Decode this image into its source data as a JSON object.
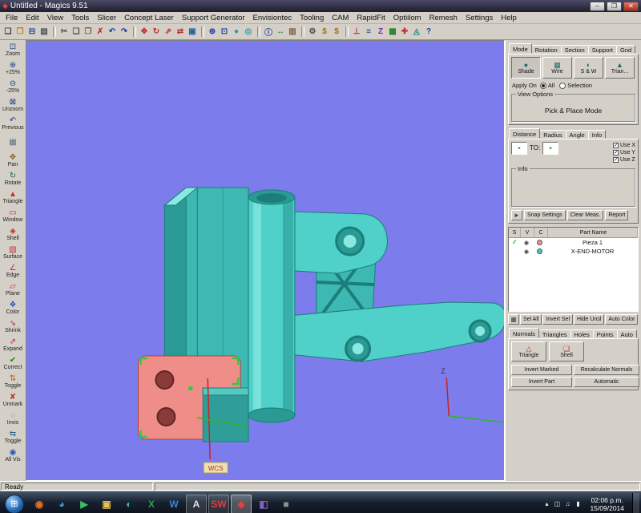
{
  "window": {
    "title": "Untitled - Magics 9.51"
  },
  "titlebar": {
    "min": "–",
    "max": "❐",
    "close": "✕"
  },
  "colors": {
    "viewport_bg": "#7c7cec",
    "model_main": "#4fd0c8",
    "model_light": "#8ae8e0",
    "model_mid": "#3db8b2",
    "model_dark": "#2a9a94",
    "model_edge": "#1b7e79",
    "part_red": "#ef8d88",
    "part_red_dark": "#a84848",
    "axis_red": "#cc2020",
    "axis_green": "#28b828",
    "select_green": "#2ecc40"
  },
  "menu": [
    {
      "name": "menu-file",
      "label": "File"
    },
    {
      "name": "menu-edit",
      "label": "Edit"
    },
    {
      "name": "menu-view",
      "label": "View"
    },
    {
      "name": "menu-tools",
      "label": "Tools"
    },
    {
      "name": "menu-slicer",
      "label": "Slicer"
    },
    {
      "name": "menu-concept-laser",
      "label": "Concept Laser"
    },
    {
      "name": "menu-support-generator",
      "label": "Support Generator"
    },
    {
      "name": "menu-envisiontec",
      "label": "Envisiontec"
    },
    {
      "name": "menu-tooling",
      "label": "Tooling"
    },
    {
      "name": "menu-cam",
      "label": "CAM"
    },
    {
      "name": "menu-rapidfit",
      "label": "RapidFit"
    },
    {
      "name": "menu-optiilom",
      "label": "Optiilom"
    },
    {
      "name": "menu-remesh",
      "label": "Remesh"
    },
    {
      "name": "menu-settings",
      "label": "Settings"
    },
    {
      "name": "menu-help",
      "label": "Help"
    }
  ],
  "toolbar": [
    {
      "name": "new-button",
      "glyph": "❏",
      "color": "#404040"
    },
    {
      "name": "open-button",
      "glyph": "❐",
      "color": "#c08020"
    },
    {
      "name": "save-button",
      "glyph": "⊟",
      "color": "#2040a0"
    },
    {
      "name": "print-button",
      "glyph": "▤",
      "color": "#505050"
    },
    {
      "name": "separator",
      "cls": "sep",
      "glyph": ""
    },
    {
      "name": "cut-button",
      "glyph": "✂",
      "color": "#505050"
    },
    {
      "name": "copy-button",
      "glyph": "❑",
      "color": "#505050"
    },
    {
      "name": "paste-button",
      "glyph": "❒",
      "color": "#806040"
    },
    {
      "name": "delete-button",
      "glyph": "✗",
      "color": "#c03030"
    },
    {
      "name": "undo-button",
      "glyph": "↶",
      "color": "#2040a0"
    },
    {
      "name": "redo-button",
      "glyph": "↷",
      "color": "#2040a0"
    },
    {
      "name": "separator",
      "cls": "sep",
      "glyph": ""
    },
    {
      "name": "translate-button",
      "glyph": "✥",
      "color": "#c03030"
    },
    {
      "name": "rotate-button",
      "glyph": "↻",
      "color": "#c03030"
    },
    {
      "name": "rescale-button",
      "glyph": "⇗",
      "color": "#c03030"
    },
    {
      "name": "mirror-button",
      "glyph": "⇄",
      "color": "#c03030"
    },
    {
      "name": "duplicate-button",
      "glyph": "▣",
      "color": "#2060a0"
    },
    {
      "name": "separator",
      "cls": "sep",
      "glyph": ""
    },
    {
      "name": "zoom-tool-button",
      "glyph": "⊕",
      "color": "#2040a0"
    },
    {
      "name": "fit-view-button",
      "glyph": "⊡",
      "color": "#2040a0"
    },
    {
      "name": "shade-view-button",
      "glyph": "●",
      "color": "#20a0a0"
    },
    {
      "name": "wire-view-button",
      "glyph": "◎",
      "color": "#20a0a0"
    },
    {
      "name": "separator",
      "cls": "sep",
      "glyph": ""
    },
    {
      "name": "info-button",
      "glyph": "ⓘ",
      "color": "#2040a0"
    },
    {
      "name": "measure-button",
      "glyph": "↔",
      "color": "#208020"
    },
    {
      "name": "report-button",
      "glyph": "▥",
      "color": "#806040"
    },
    {
      "name": "separator",
      "cls": "sep",
      "glyph": ""
    },
    {
      "name": "machine-properties-button",
      "glyph": "⚙",
      "color": "#505050"
    },
    {
      "name": "cost-button",
      "glyph": "$",
      "color": "#a07010"
    },
    {
      "name": "quote-button",
      "glyph": "$",
      "color": "#a07010"
    },
    {
      "name": "separator",
      "cls": "sep",
      "glyph": ""
    },
    {
      "name": "support-button",
      "glyph": "⊥",
      "color": "#c03030"
    },
    {
      "name": "slice-button",
      "glyph": "≡",
      "color": "#2040a0"
    },
    {
      "name": "z-compensation-button",
      "glyph": "Z",
      "color": "#7030b0"
    },
    {
      "name": "nesting-button",
      "glyph": "▦",
      "color": "#208020"
    },
    {
      "name": "fix-wizard-button",
      "glyph": "✚",
      "color": "#c03030"
    },
    {
      "name": "remesh-button",
      "glyph": "◬",
      "color": "#208080"
    },
    {
      "name": "help-button",
      "glyph": "?",
      "color": "#2040a0"
    }
  ],
  "left_toolbar": [
    {
      "name": "zoom-button",
      "label": "Zoom",
      "glyph": "⊡",
      "color": "#204080"
    },
    {
      "name": "zoom-in-25-button",
      "label": "+25%",
      "glyph": "⊕",
      "color": "#204080"
    },
    {
      "name": "zoom-out-25-button",
      "label": "-25%",
      "glyph": "⊖",
      "color": "#204080"
    },
    {
      "name": "unzoom-button",
      "label": "Unzoom",
      "glyph": "⊠",
      "color": "#204080"
    },
    {
      "name": "previous-view-button",
      "label": "Previous",
      "glyph": "↶",
      "color": "#204080"
    },
    {
      "name": "platform-view-button",
      "label": "",
      "glyph": "▦",
      "color": "#607080"
    },
    {
      "name": "pan-button",
      "label": "Pan",
      "glyph": "✥",
      "color": "#806020"
    },
    {
      "name": "rotate-view-button",
      "label": "Rotate",
      "glyph": "↻",
      "color": "#206040"
    },
    {
      "name": "mark-triangle-tool",
      "label": "Triangle",
      "glyph": "▲",
      "color": "#c03030"
    },
    {
      "name": "mark-window-tool",
      "label": "Window",
      "glyph": "▭",
      "color": "#c03030"
    },
    {
      "name": "mark-shell-tool",
      "label": "Shell",
      "glyph": "◈",
      "color": "#c03030"
    },
    {
      "name": "mark-surface-tool",
      "label": "Surface",
      "glyph": "▧",
      "color": "#c03030"
    },
    {
      "name": "mark-edge-tool",
      "label": "Edge",
      "glyph": "∠",
      "color": "#c03030"
    },
    {
      "name": "mark-plane-tool",
      "label": "Plane",
      "glyph": "▱",
      "color": "#c03030"
    },
    {
      "name": "mark-color-tool",
      "label": "Color",
      "glyph": "❖",
      "color": "#2050c0"
    },
    {
      "name": "shrink-marked-button",
      "label": "Shrink",
      "glyph": "⇘",
      "color": "#c03030"
    },
    {
      "name": "expand-marked-button",
      "label": "Expand",
      "glyph": "⇗",
      "color": "#c03030"
    },
    {
      "name": "correct-button",
      "label": "Correct",
      "glyph": "✔",
      "color": "#208020"
    },
    {
      "name": "toggle-marked-button",
      "label": "Toggle",
      "glyph": "⇅",
      "color": "#c06020"
    },
    {
      "name": "unmark-all-button",
      "label": "Unmark",
      "glyph": "✘",
      "color": "#c03030"
    },
    {
      "name": "invisible-button",
      "label": "Invis",
      "glyph": "◌",
      "color": "#607080"
    },
    {
      "name": "toggle-visibility-button",
      "label": "Toggle",
      "glyph": "⇆",
      "color": "#206080"
    },
    {
      "name": "all-visible-button",
      "label": "All Vis",
      "glyph": "◉",
      "color": "#2050c0"
    }
  ],
  "viewport": {
    "wcs_label": "WCS",
    "z_label": "Z"
  },
  "right_panel": {
    "view_tabs": [
      {
        "name": "tab-mode",
        "label": "Mode",
        "cls": "active"
      },
      {
        "name": "tab-rotation",
        "label": "Rotation"
      },
      {
        "name": "tab-section",
        "label": "Section"
      },
      {
        "name": "tab-support",
        "label": "Support"
      },
      {
        "name": "tab-grid",
        "label": "Grid"
      }
    ],
    "mode_buttons": [
      {
        "name": "shade-button",
        "label": "Shade",
        "glyph": "●",
        "cls": "active"
      },
      {
        "name": "wire-button",
        "label": "Wire",
        "glyph": "▦"
      },
      {
        "name": "shade-wire-button",
        "label": "S & W",
        "glyph": "◐"
      },
      {
        "name": "triangle-view-button",
        "label": "Trian...",
        "glyph": "▲"
      }
    ],
    "apply_on_label": "Apply On",
    "apply_options": [
      {
        "name": "apply-all-radio",
        "label": "All",
        "cls": "checked"
      },
      {
        "name": "apply-selection-radio",
        "label": "Selection"
      }
    ],
    "view_options_label": "View Options",
    "pick_place_label": "Pick & Place Mode",
    "measure_tabs": [
      {
        "name": "tab-distance",
        "label": "Distance",
        "cls": "active"
      },
      {
        "name": "tab-radius",
        "label": "Radius"
      },
      {
        "name": "tab-angle",
        "label": "Angle"
      },
      {
        "name": "tab-info",
        "label": "Info"
      }
    ],
    "point_icon": "•",
    "to_label": "TO:",
    "use_checks": [
      {
        "name": "use-x-checkbox",
        "label": "Use X",
        "cls": "checked"
      },
      {
        "name": "use-y-checkbox",
        "label": "Use Y",
        "cls": "checked"
      },
      {
        "name": "use-z-checkbox",
        "label": "Use Z",
        "cls": "checked"
      }
    ],
    "info_label": "Info",
    "snap_icon": "►",
    "measure_buttons": [
      {
        "name": "snap-settings-button",
        "label": "Snap Settings"
      },
      {
        "name": "clear-meas-button",
        "label": "Clear Meas."
      },
      {
        "name": "report-button",
        "label": "Report"
      }
    ],
    "part_list": {
      "columns": [
        "S",
        "V",
        "C",
        "Part Name"
      ]
    },
    "parts": [
      {
        "name": "Pieza 1",
        "s_mark": "∕∕",
        "v_mark": "◉",
        "color": "#f2928c"
      },
      {
        "name": "X-END-MOTOR",
        "s_mark": "",
        "v_mark": "◉",
        "color": "#35cfc7"
      }
    ],
    "sel_icon": "▦",
    "sel_buttons": [
      {
        "name": "sel-all-button",
        "label": "Sel All"
      },
      {
        "name": "invert-sel-button",
        "label": "Invert Sel"
      },
      {
        "name": "hide-unsl-button",
        "label": "Hide Unsl"
      },
      {
        "name": "auto-color-button",
        "label": "Auto Color"
      }
    ],
    "fix_tabs": [
      {
        "name": "tab-normals",
        "label": "Normals",
        "cls": "active"
      },
      {
        "name": "tab-triangles",
        "label": "Triangles"
      },
      {
        "name": "tab-holes",
        "label": "Holes"
      },
      {
        "name": "tab-points",
        "label": "Points"
      },
      {
        "name": "tab-auto",
        "label": "Auto"
      }
    ],
    "fix_mark_buttons": [
      {
        "name": "fix-triangle-button",
        "label": "Triangle",
        "glyph": "△"
      },
      {
        "name": "fix-shell-button",
        "label": "Shell",
        "glyph": "❏"
      }
    ],
    "fix_action_buttons": [
      {
        "name": "invert-marked-button",
        "label": "Invert Marked"
      },
      {
        "name": "recalculate-normals-button",
        "label": "Recalculate Normals"
      },
      {
        "name": "invert-part-button",
        "label": "Invert Part"
      },
      {
        "name": "automatic-button",
        "label": "Automatic"
      }
    ]
  },
  "statusbar": {
    "ready": "Ready"
  },
  "taskbar": {
    "start_glyph": "⊞",
    "icons": [
      {
        "name": "taskbar-app-orange",
        "glyph": "◉",
        "color": "#e87020"
      },
      {
        "name": "taskbar-app-blue",
        "glyph": "◕",
        "color": "#40a0e0"
      },
      {
        "name": "taskbar-app-media",
        "glyph": "▶",
        "color": "#40c060"
      },
      {
        "name": "taskbar-folder",
        "glyph": "▣",
        "color": "#e8c050"
      },
      {
        "name": "taskbar-app-teal",
        "glyph": "◐",
        "color": "#40c0c0"
      },
      {
        "name": "taskbar-app-spreadsheet",
        "glyph": "X",
        "color": "#30a050"
      },
      {
        "name": "taskbar-app-writer",
        "glyph": "W",
        "color": "#4080d0"
      },
      {
        "name": "taskbar-app-a",
        "glyph": "A",
        "color": "#e0e0e0",
        "cls": "running"
      },
      {
        "name": "taskbar-app-sw",
        "glyph": "SW",
        "color": "#e04040",
        "cls": "running"
      },
      {
        "name": "taskbar-app-magics",
        "glyph": "◆",
        "color": "#e04040",
        "cls": "running-active"
      },
      {
        "name": "taskbar-app-purple",
        "glyph": "◧",
        "color": "#8060c0"
      },
      {
        "name": "taskbar-app-gray",
        "glyph": "■",
        "color": "#909090"
      }
    ],
    "tray": [
      {
        "name": "tray-show-hidden-icon",
        "glyph": "▴"
      },
      {
        "name": "tray-display-icon",
        "glyph": "◫"
      },
      {
        "name": "tray-volume-icon",
        "glyph": "♫"
      },
      {
        "name": "tray-network-icon",
        "glyph": "▮"
      }
    ],
    "clock": {
      "time": "02:06 p.m.",
      "date": "15/09/2014"
    }
  }
}
